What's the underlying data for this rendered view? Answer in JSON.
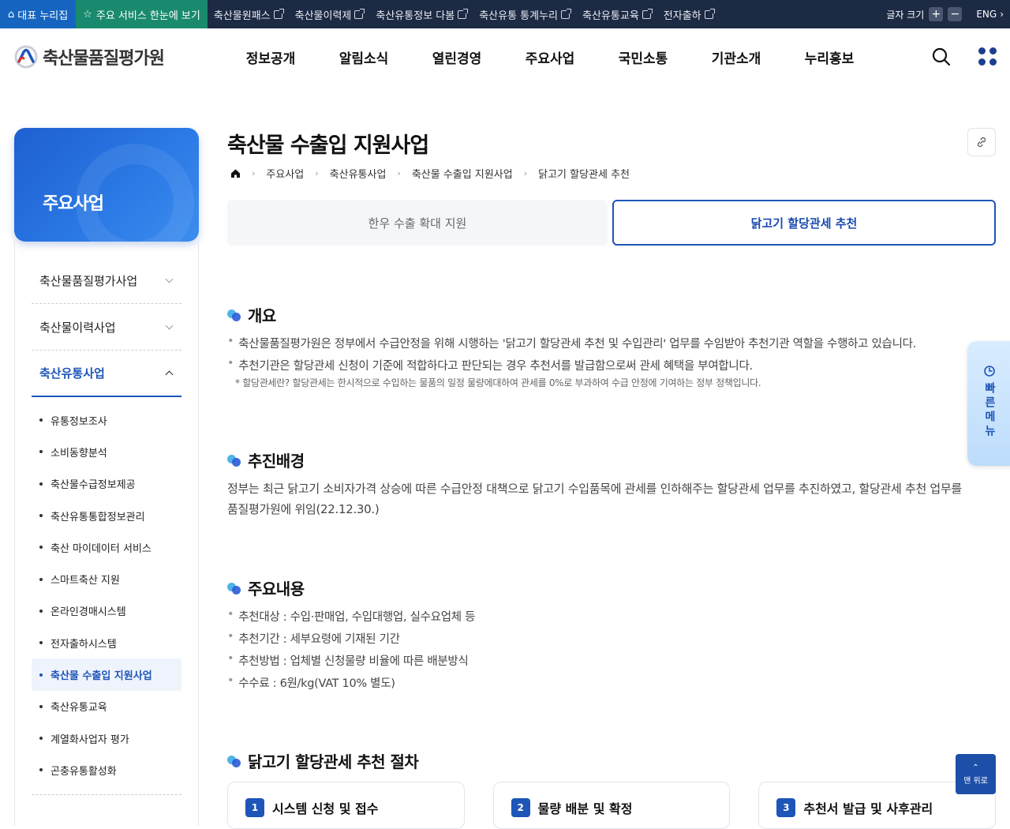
{
  "topbar": {
    "home_label": "대표 누리집",
    "services_label": "주요 서비스 한눈에 보기",
    "links": [
      "축산물원패스",
      "축산물이력제",
      "축산유통정보 다봄",
      "축산유통 통계누리",
      "축산유통교육",
      "전자출하"
    ],
    "font_size_label": "글자 크기",
    "font_plus": "+",
    "font_minus": "−",
    "lang_label": "ENG"
  },
  "header": {
    "logo_text": "축산물품질평가원",
    "nav": [
      "정보공개",
      "알림소식",
      "열린경영",
      "주요사업",
      "국민소통",
      "기관소개",
      "누리홍보"
    ]
  },
  "sidebar": {
    "title": "주요사업",
    "categories": [
      {
        "label": "축산물품질평가사업",
        "expanded": false
      },
      {
        "label": "축산물이력사업",
        "expanded": false
      },
      {
        "label": "축산유통사업",
        "expanded": true
      }
    ],
    "sub_items": [
      "유통정보조사",
      "소비동향분석",
      "축산물수급정보제공",
      "축산유통통합정보관리",
      "축산 마이데이터 서비스",
      "스마트축산 지원",
      "온라인경매시스템",
      "전자출하시스템",
      "축산물 수출입 지원사업",
      "축산유통교육",
      "계열화사업자 평가",
      "곤충유통활성화"
    ],
    "active_sub_index": 8
  },
  "page": {
    "title": "축산물 수출입 지원사업",
    "breadcrumb": [
      "주요사업",
      "축산유통사업",
      "축산물 수출입 지원사업",
      "닭고기 할당관세 추천"
    ],
    "tabs": [
      {
        "label": "한우 수출 확대 지원",
        "active": false
      },
      {
        "label": "닭고기 할당관세 추천",
        "active": true
      }
    ]
  },
  "overview": {
    "heading": "개요",
    "bullets": [
      "축산물품질평가원은 정부에서 수급안정을 위해 시행하는 '닭고기 할당관세 추천 및 수입관리' 업무를 수임받아 추천기관 역할을 수행하고 있습니다.",
      "추천기관은 할당관세 신청이 기준에 적합하다고 판단되는 경우 추천서를 발급함으로써 관세 혜택을 부여합니다."
    ],
    "note": "* 할당관세란? 할당관세는 한시적으로 수입하는 물품의 일정 물량에대하여 관세를 0%로 부과하여 수급 안정에 기여하는 정부 정책입니다."
  },
  "background": {
    "heading": "추진배경",
    "text": "정부는 최근 닭고기 소비자가격 상승에 따른 수급안정 대책으로 닭고기 수입품목에 관세를 인하해주는 할당관세 업무를 추진하였고, 할당관세 추천 업무를 품질평가원에 위임(22.12.30.)"
  },
  "main_content": {
    "heading": "주요내용",
    "bullets": [
      "추천대상 : 수입·판매업, 수입대행업, 실수요업체 등",
      "추천기간 : 세부요령에 기재된 기간",
      "추천방법 : 업체별 신청물량 비율에 따른 배분방식",
      "수수료 : 6원/kg(VAT 10% 별도)"
    ]
  },
  "procedure": {
    "heading": "닭고기 할당관세 추천 절차",
    "steps": [
      {
        "num": "1",
        "label": "시스템 신청 및 접수"
      },
      {
        "num": "2",
        "label": "물량 배분 및 확정"
      },
      {
        "num": "3",
        "label": "추천서 발급 및 사후관리"
      }
    ]
  },
  "floating": {
    "quick_menu": "빠른메뉴",
    "top_label": "맨 위로"
  },
  "colors": {
    "topbar_bg": "#1d2a44",
    "accent": "#1e55b8",
    "service_bg": "#1a8a6e"
  }
}
